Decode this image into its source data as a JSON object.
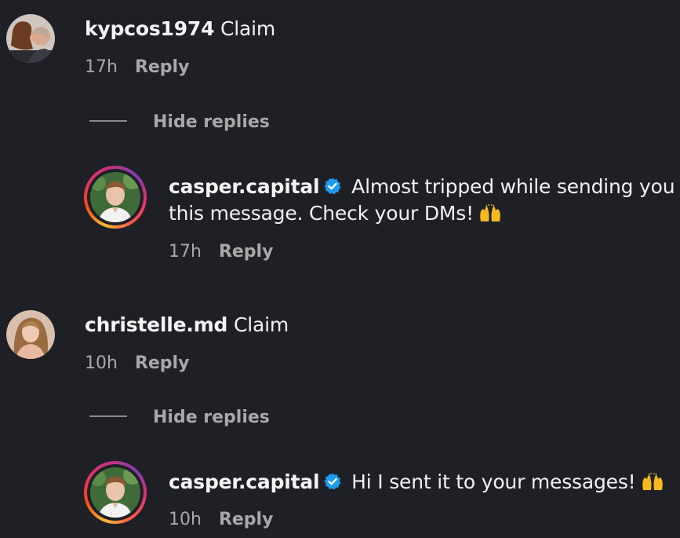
{
  "comments": [
    {
      "username": "kypcos1974",
      "text": " Claim",
      "time": "17h",
      "reply_label": "Reply",
      "avatar_icon": "couple-photo-avatar",
      "hide_replies_label": "Hide replies",
      "replies": [
        {
          "username": "casper.capital",
          "verified": true,
          "text_line1": " Almost tripped while sending you",
          "text_line2": "this message. Check your DMs!",
          "emoji": "raising-hands-emoji",
          "time": "17h",
          "reply_label": "Reply"
        }
      ]
    },
    {
      "username": "christelle.md",
      "text": " Claim",
      "time": "10h",
      "reply_label": "Reply",
      "avatar_icon": "woman-photo-avatar",
      "hide_replies_label": "Hide replies",
      "replies": [
        {
          "username": "casper.capital",
          "verified": true,
          "text_line1": " Hi I sent it to your messages!",
          "emoji": "raising-hands-emoji",
          "time": "10h",
          "reply_label": "Reply"
        }
      ]
    }
  ],
  "colors": {
    "background": "#1f2025",
    "verified": "#1d9bf0",
    "muted": "#a8a8a8"
  }
}
